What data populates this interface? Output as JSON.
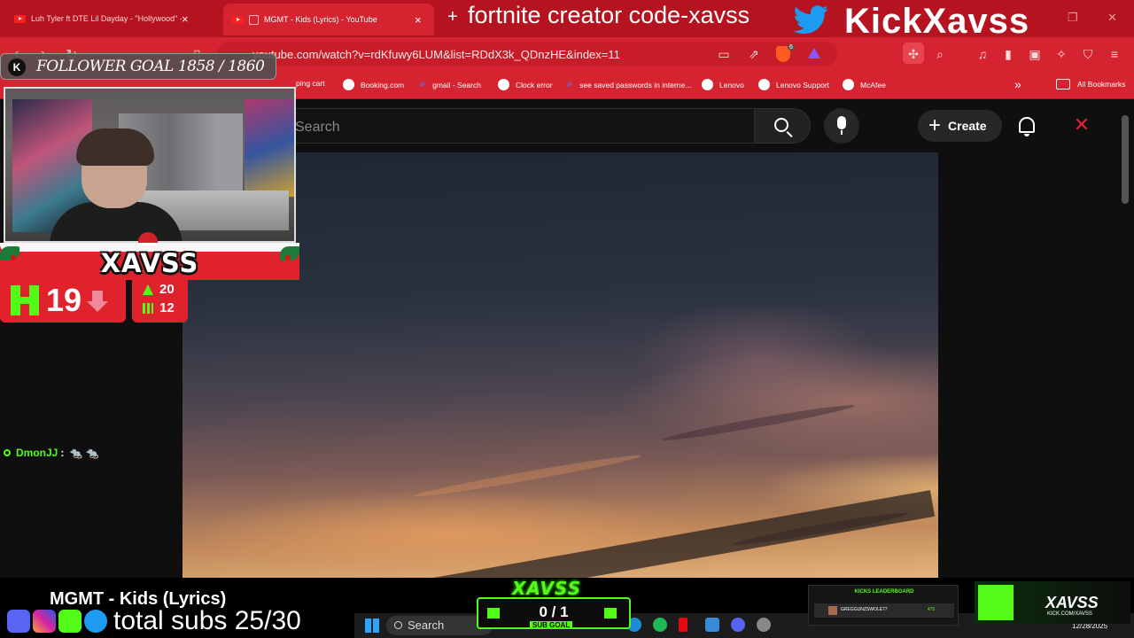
{
  "browser": {
    "tabs": [
      {
        "title": "Luh Tyler ft DTE Lil Dayday - \"Hollywood\" - YouTub",
        "active": false
      },
      {
        "title": "MGMT - Kids (Lyrics) - YouTube",
        "active": true
      }
    ],
    "url": "youtube.com/watch?v=rdKfuwy6LUM&list=RDdX3k_QDnzHE&index=11",
    "extension_badge": "6",
    "bookmarks": [
      "ping cart",
      "Booking.com",
      "gmail - Search",
      "Clock error",
      "see saved passwords in interne...",
      "Lenovo",
      "Lenovo Support",
      "McAfee"
    ],
    "all_bookmarks": "All Bookmarks"
  },
  "youtube": {
    "search_placeholder": "Search",
    "create_label": "Create"
  },
  "overlay": {
    "promo": "fortnite creator code-xavss",
    "kick_handle": "KickXavss",
    "follower_goal": "FOLLOWER GOAL 1858 / 1860",
    "streamer_name": "XAVSS",
    "viewer_count": "19",
    "stat_upvotes": "20",
    "stat_bars": "12",
    "chat": {
      "user": "DmonJJ",
      "colon": ":",
      "emotes": "🐀 🐀"
    },
    "song_title": "MGMT - Kids (Lyrics)",
    "total_subs": "total subs 25/30",
    "sub_goal": {
      "brand": "XAVSS",
      "count": "0 / 1",
      "label": "SUB GOAL"
    },
    "leaderboard": {
      "title": "KICKS LEADERBOARD",
      "user": "GREGGUNZSWOLE77",
      "value": "475"
    },
    "kick_brand": {
      "name": "XAVSS",
      "url": "KICK.COM/XAVSS"
    }
  },
  "taskbar": {
    "search_label": "Search",
    "date": "12/28/2025"
  },
  "colors": {
    "chrome_red": "#d5232f",
    "kick_green": "#53fc18",
    "youtube_bg": "#0f0f0f"
  }
}
